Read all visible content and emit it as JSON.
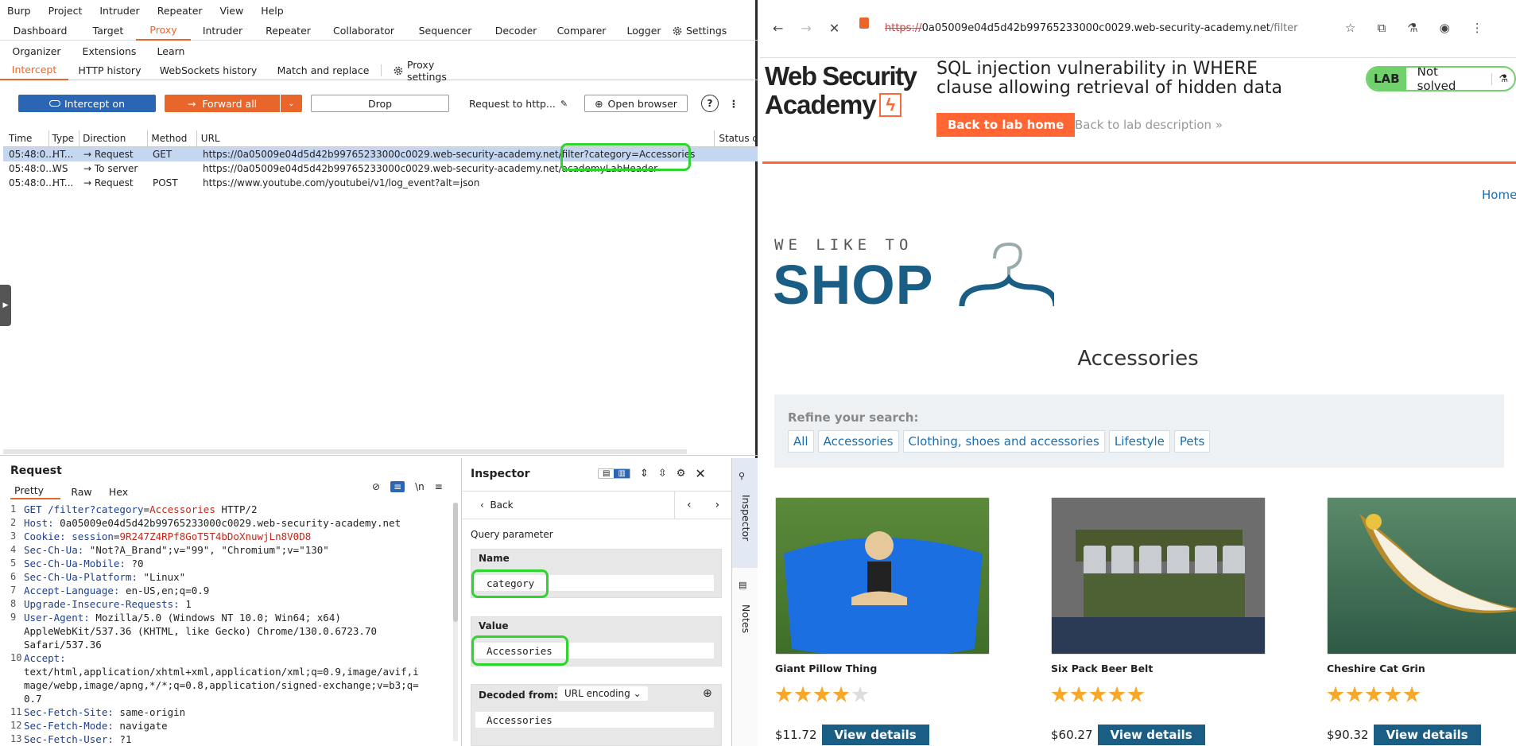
{
  "burp": {
    "menu": [
      "Burp",
      "Project",
      "Intruder",
      "Repeater",
      "View",
      "Help"
    ],
    "tabs_row1": [
      "Dashboard",
      "Target",
      "Proxy",
      "Intruder",
      "Repeater",
      "Collaborator",
      "Sequencer",
      "Decoder",
      "Comparer",
      "Logger",
      "Settings"
    ],
    "tabs_row1_active": "Proxy",
    "tabs_row2": [
      "Organizer",
      "Extensions",
      "Learn"
    ],
    "subtabs": [
      "Intercept",
      "HTTP history",
      "WebSockets history",
      "Match and replace",
      "Proxy settings"
    ],
    "subtab_active": "Intercept",
    "toolbar": {
      "intercept": "Intercept on",
      "forward": "Forward all",
      "drop": "Drop",
      "request_to": "Request to http...",
      "open_browser": "Open browser"
    },
    "table": {
      "headers": [
        "Time",
        "Type",
        "Direction",
        "Method",
        "URL",
        "Status c"
      ],
      "rows": [
        {
          "time": "05:48:0...",
          "type": "HT...",
          "direction": "Request",
          "method": "GET",
          "url": "https://0a05009e04d5d42b99765233000c0029.web-security-academy.net/filter?category=Accessories"
        },
        {
          "time": "05:48:0...",
          "type": "WS",
          "direction": "To server",
          "method": "",
          "url": "https://0a05009e04d5d42b99765233000c0029.web-security-academy.net/academyLabHeader"
        },
        {
          "time": "05:48:0...",
          "type": "HT...",
          "direction": "Request",
          "method": "POST",
          "url": "https://www.youtube.com/youtubei/v1/log_event?alt=json"
        }
      ]
    },
    "request": {
      "title": "Request",
      "tabs": [
        "Pretty",
        "Raw",
        "Hex"
      ],
      "lines": [
        {
          "n": "1",
          "k": "GET /filter?",
          "kv": "category",
          "eq": "=",
          "v": "Accessories",
          "rest": " HTTP/2"
        },
        {
          "n": "2",
          "k": "Host:",
          "rest": " 0a05009e04d5d42b99765233000c0029.web-security-academy.net"
        },
        {
          "n": "3",
          "k": "Cookie:",
          "kv": " session",
          "eq": "=",
          "v": "9R247Z4RPf8GoT5T4bDoXnuwjLn8V0D8",
          "rest": ""
        },
        {
          "n": "4",
          "k": "Sec-Ch-Ua:",
          "rest": " \"Not?A_Brand\";v=\"99\", \"Chromium\";v=\"130\""
        },
        {
          "n": "5",
          "k": "Sec-Ch-Ua-Mobile:",
          "rest": " ?0"
        },
        {
          "n": "6",
          "k": "Sec-Ch-Ua-Platform:",
          "rest": " \"Linux\""
        },
        {
          "n": "7",
          "k": "Accept-Language:",
          "rest": " en-US,en;q=0.9"
        },
        {
          "n": "8",
          "k": "Upgrade-Insecure-Requests:",
          "rest": " 1"
        },
        {
          "n": "9",
          "k": "User-Agent:",
          "rest": " Mozilla/5.0 (Windows NT 10.0; Win64; x64)"
        },
        {
          "n": "",
          "k": "",
          "rest": "AppleWebKit/537.36 (KHTML, like Gecko) Chrome/130.0.6723.70"
        },
        {
          "n": "",
          "k": "",
          "rest": "Safari/537.36"
        },
        {
          "n": "10",
          "k": "Accept:",
          "rest": ""
        },
        {
          "n": "",
          "k": "",
          "rest": "text/html,application/xhtml+xml,application/xml;q=0.9,image/avif,i"
        },
        {
          "n": "",
          "k": "",
          "rest": "mage/webp,image/apng,*/*;q=0.8,application/signed-exchange;v=b3;q="
        },
        {
          "n": "",
          "k": "",
          "rest": "0.7"
        },
        {
          "n": "11",
          "k": "Sec-Fetch-Site:",
          "rest": " same-origin"
        },
        {
          "n": "12",
          "k": "Sec-Fetch-Mode:",
          "rest": " navigate"
        },
        {
          "n": "13",
          "k": "Sec-Fetch-User:",
          "rest": " ?1"
        }
      ]
    },
    "inspector": {
      "title": "Inspector",
      "back": "Back",
      "section": "Query parameter",
      "name_label": "Name",
      "name_value": "category",
      "value_label": "Value",
      "value_value": "Accessories",
      "decoded_label": "Decoded from:",
      "decoded_select": "URL encoding",
      "decoded_value": "Accessories"
    },
    "side_tabs": [
      "Inspector",
      "Notes"
    ]
  },
  "browser": {
    "url_prefix": "https://",
    "url_rest": "0a05009e04d5d42b99765233000c0029.web-security-academy.net",
    "url_path": "/filter?categ...",
    "logo_line1": "Web Security",
    "logo_line2": "Academy",
    "lab_title": "SQL injection vulnerability in WHERE clause allowing retrieval of hidden data",
    "lab_badge": "LAB",
    "lab_status": "Not solved",
    "back_home": "Back to lab home",
    "back_desc": "Back to lab description",
    "home_link": "Home",
    "shop_tagline": "WE LIKE TO",
    "shop_word": "SHOP",
    "heading": "Accessories",
    "refine": "Refine your search:",
    "filters": [
      "All",
      "Accessories",
      "Clothing, shoes and accessories",
      "Lifestyle",
      "Pets"
    ],
    "products": [
      {
        "name": "Giant Pillow Thing",
        "price": "$11.72",
        "rating": 4,
        "button": "View details"
      },
      {
        "name": "Six Pack Beer Belt",
        "price": "$60.27",
        "rating": 5,
        "button": "View details"
      },
      {
        "name": "Cheshire Cat Grin",
        "price": "$90.32",
        "rating": 5,
        "button": "View details"
      }
    ]
  },
  "colors": {
    "burp_orange": "#e8662c",
    "intercept_blue": "#2a66b3",
    "academy_orange": "#ff6633",
    "shop_blue": "#1a5e86",
    "highlight_green": "#2ed52e"
  }
}
